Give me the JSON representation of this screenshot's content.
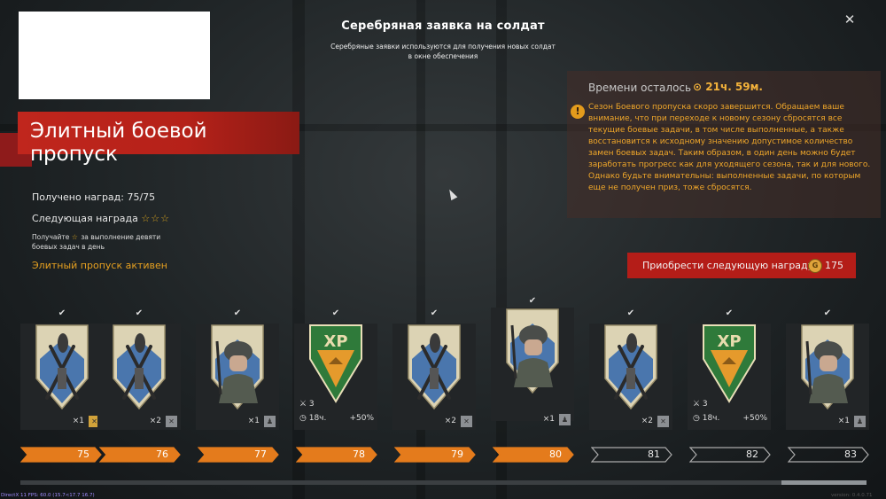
{
  "header": {
    "title": "Серебряная заявка на солдат",
    "subtitle": "Серебряные заявки используются для получения новых солдат в окне обеспечения"
  },
  "pass": {
    "title": "Элитный боевой пропуск",
    "rewards_label": "Получено наград: 75/75",
    "next_reward_label": "Следующая награда",
    "next_reward_stars": "☆☆☆",
    "hint_pre": "Получайте",
    "hint_star": "☆",
    "hint_post": "за выполнение девяти боевых задач в день",
    "active_label": "Элитный пропуск активен"
  },
  "timer": {
    "label": "Времени осталось",
    "value": "21ч. 59м.",
    "warning": "Сезон Боевого пропуска скоро завершится. Обращаем ваше внимание, что при переходе к новому сезону сбросятся все текущие боевые задачи, в том числе выполненные, а также восстановится к исходному значению допустимое количество замен боевых задач. Таким образом, в один день можно будет заработать прогресс как для уходящего сезона, так и для нового. Однако будьте внимательны: выполненные задачи, по которым еще не получен приз, тоже сбросятся."
  },
  "buy_button": {
    "label": "Приобрести следующую награду",
    "price": "175"
  },
  "rewards": [
    {
      "type": "rocket",
      "qty": "×1",
      "level": "75",
      "completed": true
    },
    {
      "type": "rocket",
      "qty": "×2",
      "level": "76",
      "completed": true
    },
    {
      "type": "soldier",
      "qty": "×1",
      "level": "77",
      "completed": true
    },
    {
      "type": "xp",
      "missions": "3",
      "duration": "18ч.",
      "bonus": "+50%",
      "level": "78",
      "completed": true
    },
    {
      "type": "rocket",
      "qty": "×2",
      "level": "79",
      "completed": true
    },
    {
      "type": "soldier",
      "qty": "×1",
      "level": "80",
      "completed": true
    },
    {
      "type": "rocket",
      "qty": "×2",
      "level": "81",
      "completed": false
    },
    {
      "type": "xp",
      "missions": "3",
      "duration": "18ч.",
      "bonus": "+50%",
      "level": "82",
      "completed": false
    },
    {
      "type": "soldier",
      "qty": "×1",
      "level": "83",
      "completed": false
    }
  ],
  "footer": {
    "fps": "DirectX 11 FPS: 60.0 (15.7<17.7 16.7)",
    "version": "version: 0.4.0.71"
  },
  "colors": {
    "accent_red": "#b41d18",
    "accent_orange": "#e47b1c",
    "gold": "#f3b23b"
  }
}
